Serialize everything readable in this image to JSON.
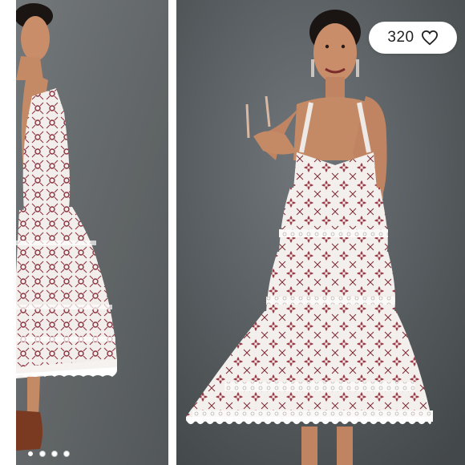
{
  "listing": {
    "like_count": "320",
    "like_icon": "heart-outline-icon"
  },
  "carousel": {
    "slide_count": 4,
    "active_index": 0
  },
  "colors": {
    "backdrop": "#5f6466",
    "dress_base": "#f3efec",
    "embroidery": "#8a2f3c",
    "skin": "#c98d6a",
    "hair": "#1a1412"
  }
}
